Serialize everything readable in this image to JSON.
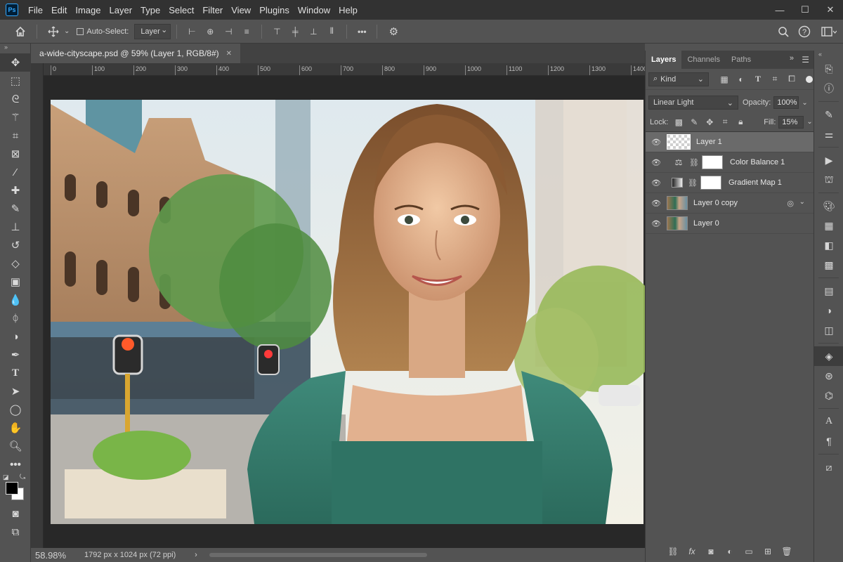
{
  "app": {
    "logo_text": "Ps"
  },
  "menu": [
    "File",
    "Edit",
    "Image",
    "Layer",
    "Type",
    "Select",
    "Filter",
    "View",
    "Plugins",
    "Window",
    "Help"
  ],
  "window_controls": {
    "minimize": "—",
    "maximize": "☐",
    "close": "✕"
  },
  "options_bar": {
    "auto_select_label": "Auto-Select:",
    "auto_select_checked": false,
    "auto_select_target": "Layer",
    "more_label": "•••"
  },
  "document": {
    "tab_title": "a-wide-cityscape.psd @ 59% (Layer 1, RGB/8#)",
    "close_glyph": "✕"
  },
  "ruler_ticks": [
    "0",
    "100",
    "200",
    "300",
    "400",
    "500",
    "600",
    "700",
    "800",
    "900",
    "1000",
    "1100",
    "1200",
    "1300",
    "1400"
  ],
  "status": {
    "zoom": "58.98%",
    "dimensions": "1792 px x 1024 px (72 ppi)",
    "arrow": "›"
  },
  "layers_panel": {
    "tabs": [
      "Layers",
      "Channels",
      "Paths"
    ],
    "active_tab": "Layers",
    "filter_kind": "Kind",
    "blend_mode": "Linear Light",
    "opacity_label": "Opacity:",
    "opacity": "100%",
    "lock_label": "Lock:",
    "fill_label": "Fill:",
    "fill": "15%",
    "layers": [
      {
        "name": "Layer 1",
        "type": "pixel-transparent",
        "visible": true,
        "selected": true
      },
      {
        "name": "Color Balance 1",
        "type": "adjustment-color-balance",
        "visible": true,
        "selected": false
      },
      {
        "name": "Gradient Map 1",
        "type": "adjustment-gradient-map",
        "visible": true,
        "selected": false
      },
      {
        "name": "Layer 0 copy",
        "type": "smart-object",
        "visible": true,
        "selected": false
      },
      {
        "name": "Layer 0",
        "type": "pixel-photo",
        "visible": true,
        "selected": false
      }
    ]
  },
  "colors": {
    "foreground": "#000000",
    "background": "#ffffff",
    "ui_dark": "#323232",
    "ui_mid": "#535353",
    "accent": "#31a8ff"
  }
}
